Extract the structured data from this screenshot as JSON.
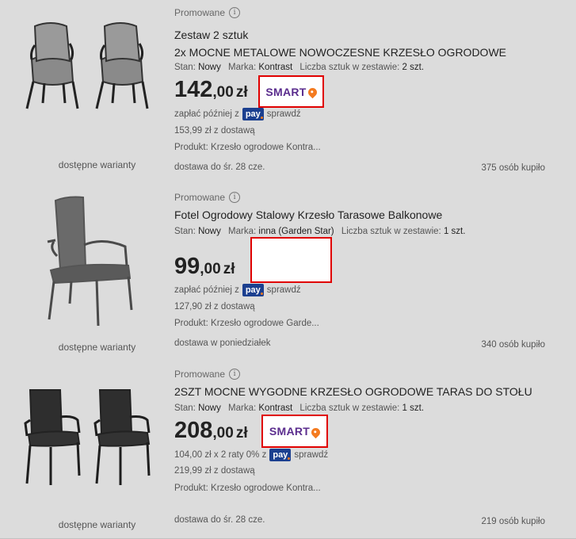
{
  "listings": [
    {
      "promo_label": "Promowane",
      "title_line1": "Zestaw 2 sztuk",
      "title_line2": "2x MOCNE METALOWE NOWOCZESNE KRZESŁO OGRODOWE",
      "params": {
        "condition_label": "Stan:",
        "condition": "Nowy",
        "brand_label": "Marka:",
        "brand": "Kontrast",
        "qty_label": "Liczba sztuk w zestawie:",
        "qty": "2 szt."
      },
      "price_main": "142",
      "price_cents": ",00",
      "currency": "zł",
      "smart_label": "SMART",
      "pay_prefix": "zapłać później z",
      "pay_badge": "pay",
      "pay_suffix": "sprawdź",
      "with_delivery": "153,99 zł z dostawą",
      "product": "Produkt: Krzesło ogrodowe Kontra...",
      "delivery": "dostawa do śr. 28 cze.",
      "bought": "375 osób kupiło",
      "variants": "dostępne warianty"
    },
    {
      "promo_label": "Promowane",
      "title_line1": "Fotel Ogrodowy Stalowy Krzesło Tarasowe Balkonowe",
      "params": {
        "condition_label": "Stan:",
        "condition": "Nowy",
        "brand_label": "Marka:",
        "brand": "inna (Garden Star)",
        "qty_label": "Liczba sztuk w zestawie:",
        "qty": "1 szt."
      },
      "price_main": "99",
      "price_cents": ",00",
      "currency": "zł",
      "pay_prefix": "zapłać później z",
      "pay_badge": "pay",
      "pay_suffix": "sprawdź",
      "with_delivery": "127,90 zł z dostawą",
      "product": "Produkt: Krzesło ogrodowe Garde...",
      "delivery": "dostawa w poniedziałek",
      "bought": "340 osób kupiło",
      "variants": "dostępne warianty"
    },
    {
      "promo_label": "Promowane",
      "title_line1": "2SZT MOCNE WYGODNE KRZESŁO OGRODOWE TARAS DO STOŁU",
      "params": {
        "condition_label": "Stan:",
        "condition": "Nowy",
        "brand_label": "Marka:",
        "brand": "Kontrast",
        "qty_label": "Liczba sztuk w zestawie:",
        "qty": "1 szt."
      },
      "price_main": "208",
      "price_cents": ",00",
      "currency": "zł",
      "smart_label": "SMART",
      "pay_prefix": "104,00 zł x 2 raty 0% z",
      "pay_badge": "pay",
      "pay_suffix": "sprawdź",
      "with_delivery": "219,99 zł z dostawą",
      "product": "Produkt: Krzesło ogrodowe Kontra...",
      "delivery": "dostawa do śr. 28 cze.",
      "bought": "219 osób kupiło",
      "variants": "dostępne warianty"
    }
  ],
  "colors": {
    "background": "#dcdcdc",
    "smart_purple": "#5b2d8e",
    "smart_orange": "#f47b20",
    "highlight_border": "#e00000",
    "pay_blue": "#1b3f8f"
  }
}
